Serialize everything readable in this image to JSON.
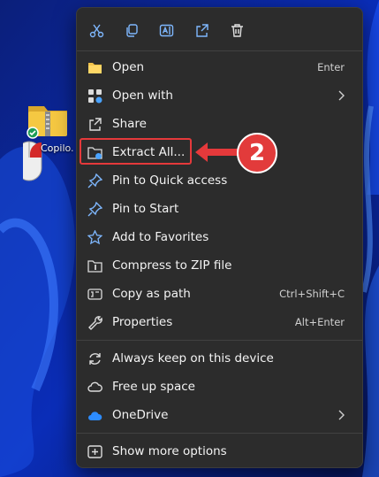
{
  "desktop": {
    "icon_label": "Copilo."
  },
  "toolbar": {
    "buttons": [
      "cut-icon",
      "copy-icon",
      "rename-icon",
      "share-icon",
      "delete-icon"
    ]
  },
  "menu": {
    "open": {
      "label": "Open",
      "shortcut": "Enter"
    },
    "open_with": {
      "label": "Open with"
    },
    "share": {
      "label": "Share"
    },
    "extract_all": {
      "label": "Extract All..."
    },
    "pin_quick": {
      "label": "Pin to Quick access"
    },
    "pin_start": {
      "label": "Pin to Start"
    },
    "favorites": {
      "label": "Add to Favorites"
    },
    "compress": {
      "label": "Compress to ZIP file"
    },
    "copy_path": {
      "label": "Copy as path",
      "shortcut": "Ctrl+Shift+C"
    },
    "properties": {
      "label": "Properties",
      "shortcut": "Alt+Enter"
    },
    "always_keep": {
      "label": "Always keep on this device"
    },
    "free_space": {
      "label": "Free up space"
    },
    "onedrive": {
      "label": "OneDrive"
    },
    "more_options": {
      "label": "Show more options"
    }
  },
  "annotation": {
    "step_number": "2",
    "color": "#e5393b"
  }
}
